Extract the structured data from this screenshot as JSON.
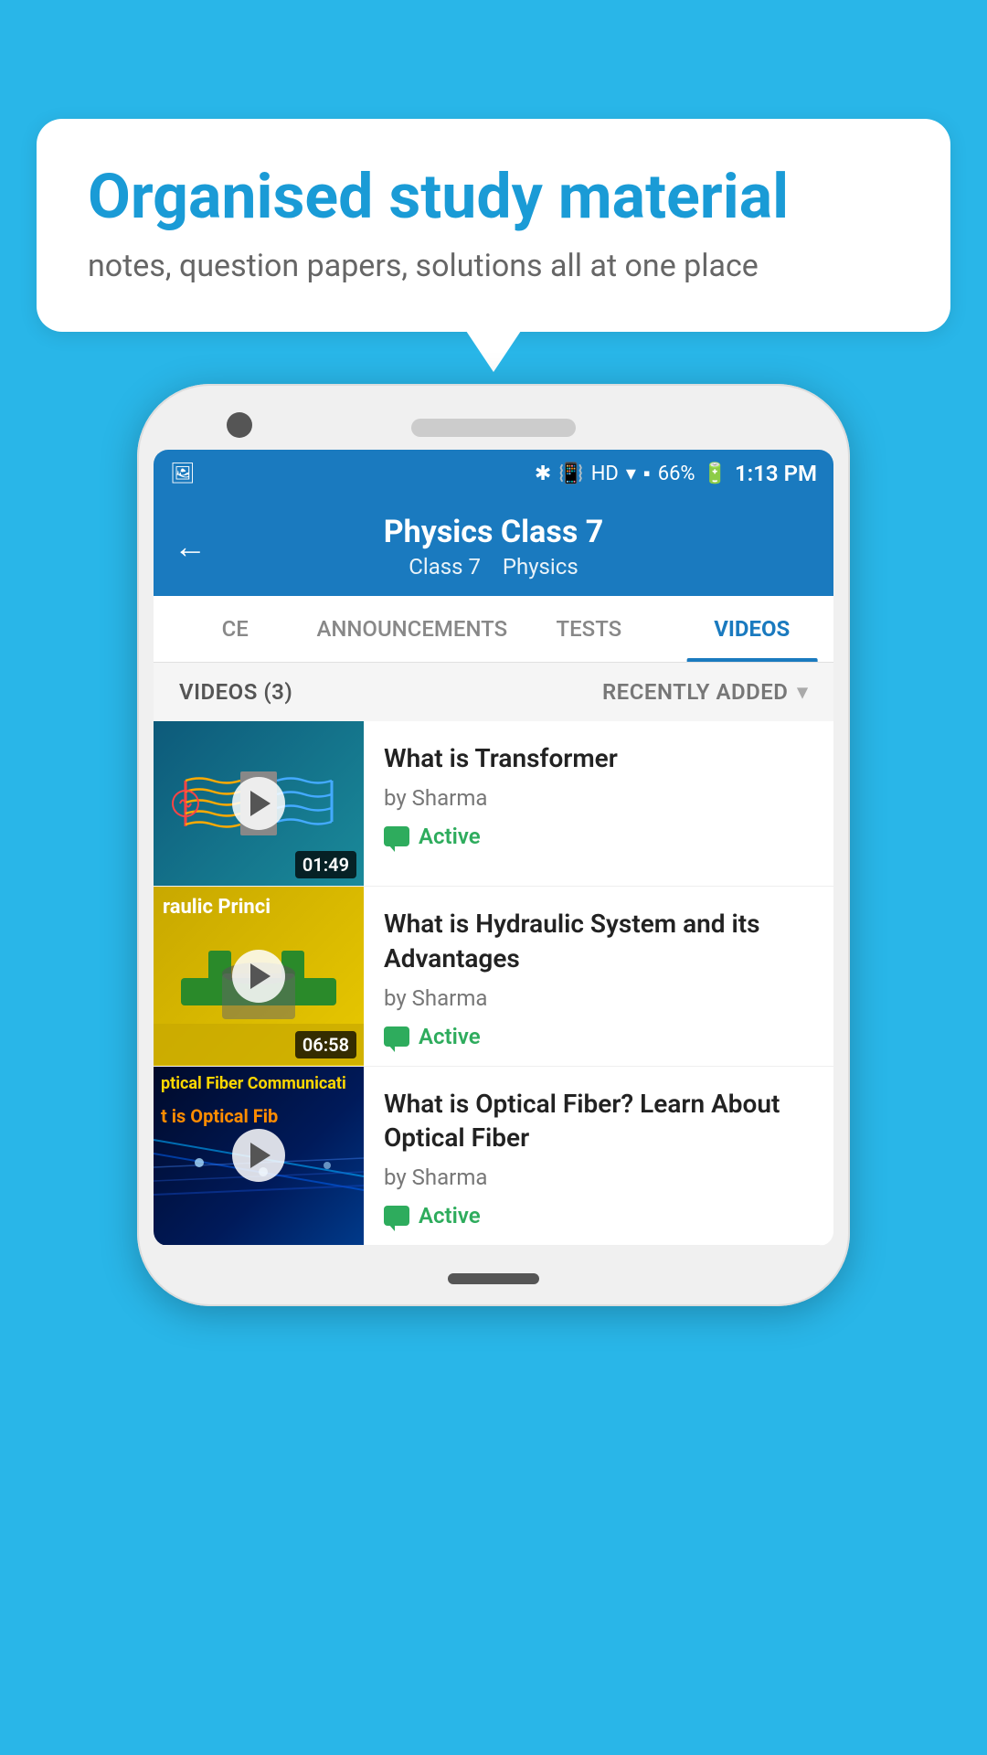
{
  "background_color": "#29b6e8",
  "bubble": {
    "title": "Organised study material",
    "subtitle": "notes, question papers, solutions all at one place"
  },
  "status_bar": {
    "time": "1:13 PM",
    "battery": "66%",
    "signal": "HD"
  },
  "header": {
    "back_label": "←",
    "title": "Physics Class 7",
    "subtitle_class": "Class 7",
    "subtitle_subject": "Physics"
  },
  "tabs": [
    {
      "id": "ce",
      "label": "CE",
      "active": false
    },
    {
      "id": "announcements",
      "label": "ANNOUNCEMENTS",
      "active": false
    },
    {
      "id": "tests",
      "label": "TESTS",
      "active": false
    },
    {
      "id": "videos",
      "label": "VIDEOS",
      "active": true
    }
  ],
  "filter_bar": {
    "count_label": "VIDEOS (3)",
    "sort_label": "RECENTLY ADDED"
  },
  "videos": [
    {
      "title": "What is  Transformer",
      "author": "by Sharma",
      "status": "Active",
      "duration": "01:49",
      "thumb_type": "transformer"
    },
    {
      "title": "What is Hydraulic System and its Advantages",
      "author": "by Sharma",
      "status": "Active",
      "duration": "06:58",
      "thumb_type": "hydraulic",
      "thumb_text1": "raulic Princi",
      "thumb_text2": ""
    },
    {
      "title": "What is Optical Fiber? Learn About Optical Fiber",
      "author": "by Sharma",
      "status": "Active",
      "duration": "",
      "thumb_type": "optical",
      "thumb_text1": "ptical Fiber Communicati",
      "thumb_text2": "t is Optical Fib"
    }
  ]
}
